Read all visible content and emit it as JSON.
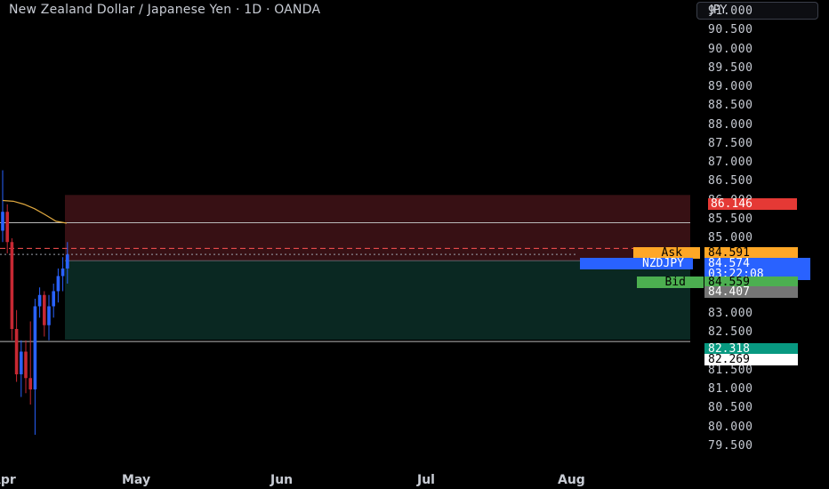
{
  "header": {
    "title": "New Zealand Dollar / Japanese Yen · 1D · OANDA",
    "currency_button": "JPY"
  },
  "price_scale": {
    "ticks": [
      "91.000",
      "90.500",
      "90.000",
      "89.500",
      "89.000",
      "88.500",
      "88.000",
      "87.500",
      "87.000",
      "86.500",
      "86.000",
      "85.500",
      "85.000",
      "84.500",
      "84.000",
      "83.500",
      "83.000",
      "82.500",
      "82.000",
      "81.500",
      "81.000",
      "80.500",
      "80.000",
      "79.500"
    ]
  },
  "time_axis": {
    "months": [
      "Apr",
      "May",
      "Jun",
      "Jul",
      "Aug"
    ]
  },
  "labels": {
    "stop_loss": "86.146",
    "ask_tag": "Ask",
    "ask_price": "84.591",
    "symbol_tag": "NZDJPY",
    "last_price": "84.574",
    "countdown": "03:22:08",
    "bid_tag": "Bid",
    "bid_price": "84.559",
    "entry_price": "84.407",
    "target_price": "82.318",
    "line_price": "82.269"
  },
  "colors": {
    "bull": "#2962ff",
    "bear": "#c62833",
    "stop": "#e53935",
    "ask": "#ffa726",
    "last": "#2962ff",
    "bid": "#4caf50",
    "entry": "#757575",
    "target": "#089981",
    "ma": "#e0a940"
  },
  "position": {
    "type": "short",
    "entry": 84.407,
    "stop": 86.146,
    "target": 82.318
  },
  "horizontal_lines": [
    85.412,
    82.269
  ],
  "chart_data": {
    "type": "candlestick",
    "symbol": "NZDJPY",
    "candles": [
      {
        "o": 85.2,
        "h": 86.8,
        "l": 84.9,
        "c": 85.7
      },
      {
        "o": 85.7,
        "h": 85.9,
        "l": 84.6,
        "c": 84.9
      },
      {
        "o": 84.9,
        "h": 85.0,
        "l": 82.3,
        "c": 82.6
      },
      {
        "o": 82.6,
        "h": 83.1,
        "l": 81.2,
        "c": 81.4
      },
      {
        "o": 81.4,
        "h": 82.3,
        "l": 80.8,
        "c": 82.0
      },
      {
        "o": 82.0,
        "h": 82.3,
        "l": 80.9,
        "c": 81.3
      },
      {
        "o": 81.3,
        "h": 82.8,
        "l": 80.6,
        "c": 81.0
      },
      {
        "o": 81.0,
        "h": 83.4,
        "l": 79.8,
        "c": 83.2
      },
      {
        "o": 83.2,
        "h": 83.7,
        "l": 82.9,
        "c": 83.5
      },
      {
        "o": 83.5,
        "h": 83.6,
        "l": 82.4,
        "c": 82.7
      },
      {
        "o": 82.7,
        "h": 83.5,
        "l": 82.3,
        "c": 83.2
      },
      {
        "o": 83.2,
        "h": 83.8,
        "l": 82.9,
        "c": 83.6
      },
      {
        "o": 83.6,
        "h": 84.2,
        "l": 83.3,
        "c": 84.0
      },
      {
        "o": 84.0,
        "h": 84.5,
        "l": 83.6,
        "c": 84.2
      },
      {
        "o": 84.2,
        "h": 84.9,
        "l": 83.8,
        "c": 84.57
      }
    ],
    "moving_average": [
      86.0,
      85.98,
      85.9,
      85.78,
      85.62,
      85.45,
      85.4
    ]
  }
}
